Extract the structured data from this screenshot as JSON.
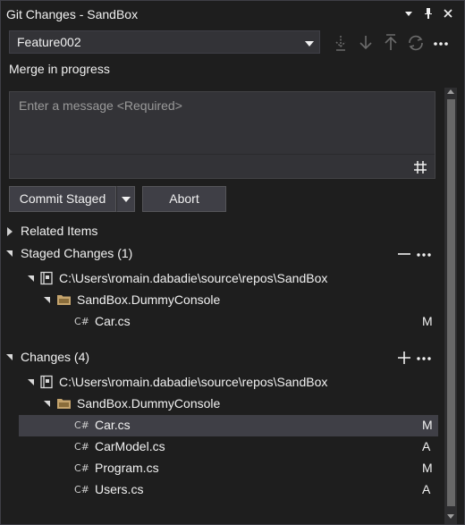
{
  "window": {
    "title": "Git Changes - SandBox",
    "icons": [
      "dropdown-arrow-icon",
      "pin-icon",
      "close-icon"
    ]
  },
  "toolbar": {
    "branch": "Feature002",
    "actions": [
      "fetch-icon",
      "pull-icon",
      "push-icon",
      "sync-icon",
      "more-icon"
    ]
  },
  "status": "Merge in progress",
  "message": {
    "placeholder": "Enter a message <Required>",
    "value": ""
  },
  "buttons": {
    "commit": "Commit Staged",
    "abort": "Abort"
  },
  "related": {
    "label": "Related Items"
  },
  "staged": {
    "label": "Staged Changes (1)",
    "repo": "C:\\Users\\romain.dabadie\\source\\repos\\SandBox",
    "project": "SandBox.DummyConsole",
    "files": [
      {
        "icon": "C#",
        "name": "Car.cs",
        "status": "M"
      }
    ]
  },
  "changes": {
    "label": "Changes (4)",
    "repo": "C:\\Users\\romain.dabadie\\source\\repos\\SandBox",
    "project": "SandBox.DummyConsole",
    "files": [
      {
        "icon": "C#",
        "name": "Car.cs",
        "status": "M",
        "selected": true
      },
      {
        "icon": "C#",
        "name": "CarModel.cs",
        "status": "A"
      },
      {
        "icon": "C#",
        "name": "Program.cs",
        "status": "M"
      },
      {
        "icon": "C#",
        "name": "Users.cs",
        "status": "A"
      }
    ]
  }
}
